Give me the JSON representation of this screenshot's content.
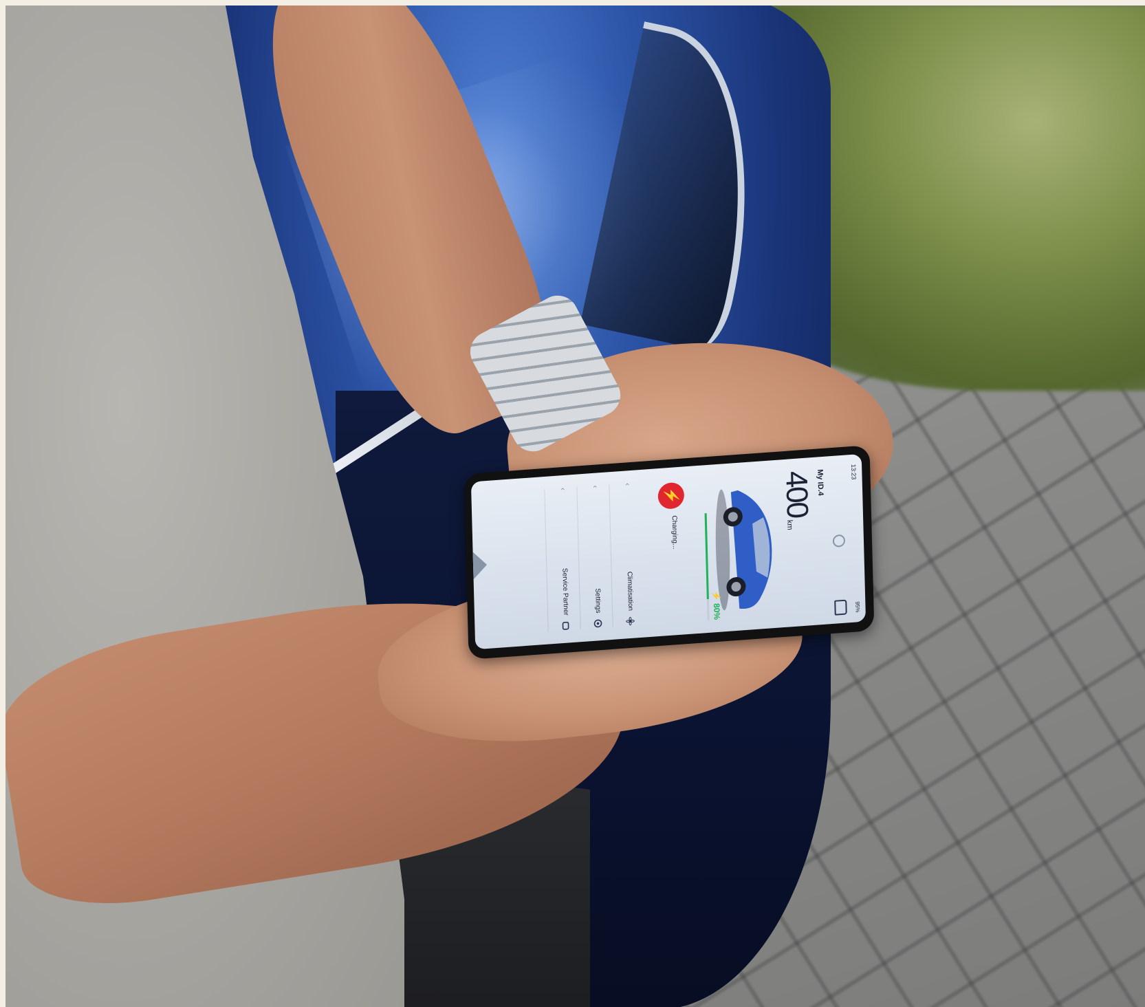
{
  "phone_app": {
    "status_time": "13:23",
    "battery_status": "95%",
    "vehicle_name": "My ID.4",
    "range_value": "400",
    "range_unit": "km",
    "charge_level_text": "80%",
    "charge_level_fraction": 0.8,
    "charging_status": "Charging...",
    "menu": [
      {
        "label": "Climatisation",
        "icon": "fan-icon"
      },
      {
        "label": "Settings",
        "icon": "gear-icon"
      },
      {
        "label": "Service Partner",
        "icon": "service-icon"
      }
    ],
    "bottom_nav": [
      "home-icon",
      "car-icon",
      "alert-icon",
      "profile-icon"
    ],
    "colors": {
      "accent_charge": "#1fb25a",
      "charge_button": "#e0262f"
    }
  }
}
